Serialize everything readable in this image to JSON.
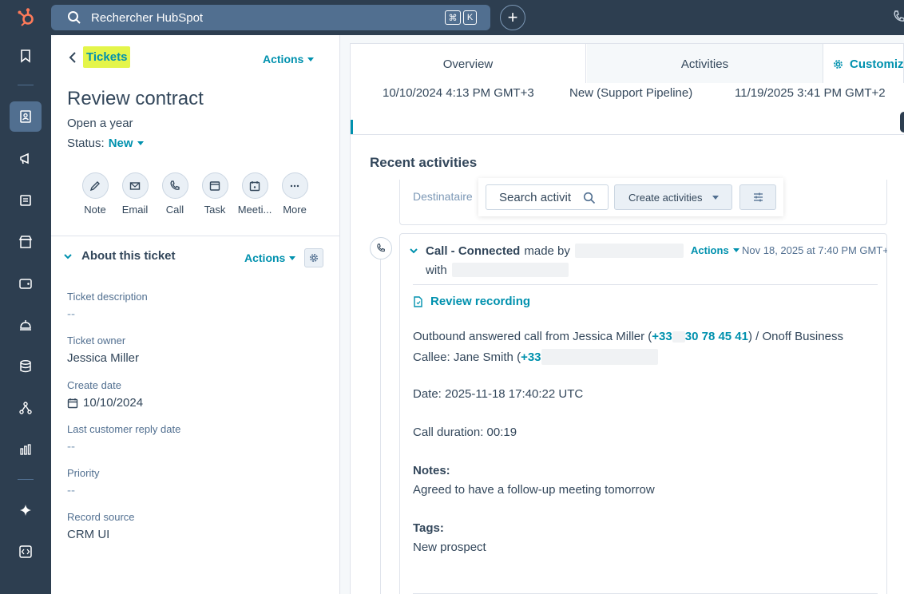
{
  "topbar": {
    "search_placeholder": "Rechercher HubSpot",
    "shortcut_keys": [
      "⌘",
      "K"
    ]
  },
  "header": {
    "breadcrumb": "Tickets",
    "actions_label": "Actions",
    "title": "Review contract",
    "subtitle": "Open a year",
    "status_label": "Status:",
    "status_value": "New"
  },
  "quick_actions": [
    {
      "label": "Note",
      "icon": "note-icon"
    },
    {
      "label": "Email",
      "icon": "email-icon"
    },
    {
      "label": "Call",
      "icon": "call-icon"
    },
    {
      "label": "Task",
      "icon": "task-icon"
    },
    {
      "label": "Meeti...",
      "icon": "meeting-icon"
    },
    {
      "label": "More",
      "icon": "more-icon"
    }
  ],
  "about": {
    "title": "About this ticket",
    "actions_label": "Actions",
    "properties": [
      {
        "label": "Ticket description",
        "value": "--"
      },
      {
        "label": "Ticket owner",
        "value": "Jessica Miller"
      },
      {
        "label": "Create date",
        "value": "10/10/2024"
      },
      {
        "label": "Last customer reply date",
        "value": "--"
      },
      {
        "label": "Priority",
        "value": "--"
      },
      {
        "label": "Record source",
        "value": "CRM UI"
      }
    ]
  },
  "tabs": {
    "overview": "Overview",
    "activities": "Activities",
    "customize": "Customize"
  },
  "summary": {
    "create_date": "10/10/2024 4:13 PM GMT+3",
    "pipeline_stage": "New (Support Pipeline)",
    "last_activity": "11/19/2025 3:41 PM GMT+2"
  },
  "recent_activities": {
    "title": "Recent activities",
    "filter_label": "Destinataire",
    "search_placeholder": "Search activit",
    "create_label": "Create activities"
  },
  "call_card": {
    "title_bold": "Call - Connected",
    "made_by": "made by",
    "with": "with",
    "actions_label": "Actions",
    "date": "Nov 18, 2025 at 7:40 PM GMT+",
    "review_label": "Review recording",
    "line1_prefix": "Outbound answered call from Jessica Miller (",
    "line1_phone_a": "+33",
    "line1_phone_b": "30 78 45 41",
    "line1_suffix": ") / Onoff Business",
    "line2_prefix": "Callee: Jane Smith (",
    "line2_phone": "+33",
    "date_line": "Date: 2025-11-18 17:40:22 UTC",
    "duration_line": "Call duration: 00:19",
    "notes_label": "Notes:",
    "notes_text": "Agreed to have a follow-up meeting tomorrow",
    "tags_label": "Tags:",
    "tags_text": "New prospect"
  },
  "colors": {
    "nav_bg": "#2d3e50",
    "accent": "#0091ae",
    "highlight": "#e4f54a",
    "text": "#33475b"
  }
}
